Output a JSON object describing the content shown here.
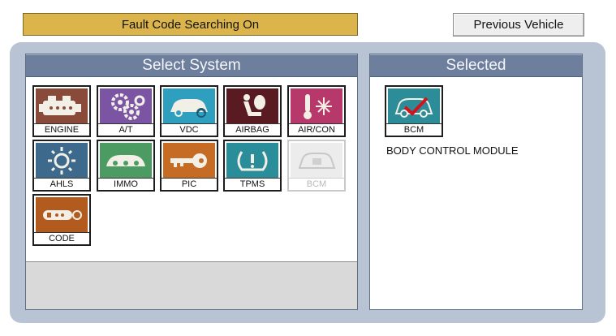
{
  "header": {
    "status_label": "Fault Code Searching On",
    "previous_vehicle_label": "Previous Vehicle"
  },
  "left_panel": {
    "title": "Select System",
    "systems": [
      {
        "label": "ENGINE",
        "icon": "engine-icon",
        "color": "#8a4a3a",
        "enabled": true
      },
      {
        "label": "A/T",
        "icon": "gears-icon",
        "color": "#7b55a4",
        "enabled": true
      },
      {
        "label": "VDC",
        "icon": "car-stability-icon",
        "color": "#2e9fbf",
        "enabled": true
      },
      {
        "label": "AIRBAG",
        "icon": "airbag-seat-icon",
        "color": "#5a1a22",
        "enabled": true
      },
      {
        "label": "AIR/CON",
        "icon": "thermometer-snowflake-icon",
        "color": "#b7386a",
        "enabled": true
      },
      {
        "label": "AHLS",
        "icon": "headlamp-icon",
        "color": "#3d6a8c",
        "enabled": true
      },
      {
        "label": "IMMO",
        "icon": "immobilizer-key-icon",
        "color": "#4b9b63",
        "enabled": true
      },
      {
        "label": "PIC",
        "icon": "smart-key-icon",
        "color": "#c56b23",
        "enabled": true
      },
      {
        "label": "TPMS",
        "icon": "tire-pressure-icon",
        "color": "#2a8e9a",
        "enabled": true
      },
      {
        "label": "BCM",
        "icon": "body-control-icon",
        "color": "#e3e3e3",
        "enabled": false
      },
      {
        "label": "CODE",
        "icon": "key-code-icon",
        "color": "#b35a1e",
        "enabled": true
      }
    ]
  },
  "right_panel": {
    "title": "Selected",
    "selected": {
      "label": "BCM",
      "icon": "body-control-icon",
      "description": "BODY CONTROL MODULE"
    }
  }
}
